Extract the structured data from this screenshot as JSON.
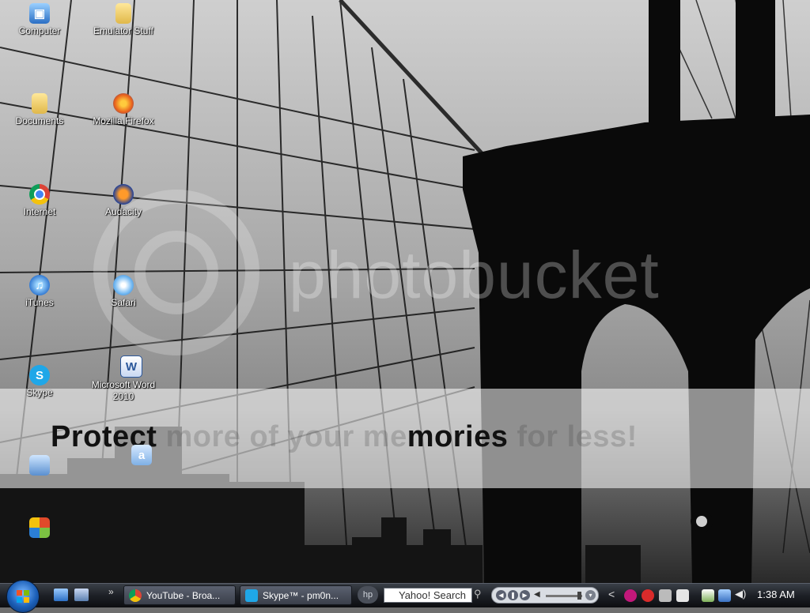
{
  "desktop": {
    "icons": [
      {
        "label": "Computer",
        "icon": "computer-icon"
      },
      {
        "label": "Emulator Stuff",
        "icon": "folder-icon"
      },
      {
        "label": "Documents",
        "icon": "folder-icon"
      },
      {
        "label": "Mozilla Firefox",
        "icon": "firefox-icon"
      },
      {
        "label": "Internet",
        "icon": "chrome-icon"
      },
      {
        "label": "Audacity",
        "icon": "audacity-icon"
      },
      {
        "label": "iTunes",
        "icon": "itunes-icon"
      },
      {
        "label": "Safari",
        "icon": "safari-icon"
      },
      {
        "label": "Skype",
        "icon": "skype-icon"
      },
      {
        "label": "Microsoft Word 2010",
        "icon": "word-icon"
      },
      {
        "label": "",
        "icon": "app-shortcut-icon"
      },
      {
        "label": "",
        "icon": "app-shortcut-icon"
      },
      {
        "label": "",
        "icon": "app-shortcut-icon"
      }
    ]
  },
  "watermark": {
    "brand": "photobucket",
    "banner_bold_start": "Protect",
    "banner_faded_middle": " more of your me",
    "banner_bold_mid": "mories",
    "banner_faded_end": " for less!"
  },
  "taskbar": {
    "start_icon": "windows-start-icon",
    "quick_launch": [
      "show-desktop-icon",
      "switch-windows-icon"
    ],
    "chevron": "»",
    "tasks": [
      {
        "label": "YouTube - Broa...",
        "icon": "chrome-icon"
      },
      {
        "label": "Skype™ - pm0n...",
        "icon": "skype-icon"
      }
    ],
    "hp_label": "hp",
    "search_value": "Yahoo! Search",
    "tray_chevron": "<",
    "clock": "1:38 AM"
  },
  "colors": {
    "taskbar_top": "#3a3f47",
    "taskbar_bottom": "#0c0d10",
    "start_orb": "#1b5fb8",
    "banner_text": "#111111"
  }
}
